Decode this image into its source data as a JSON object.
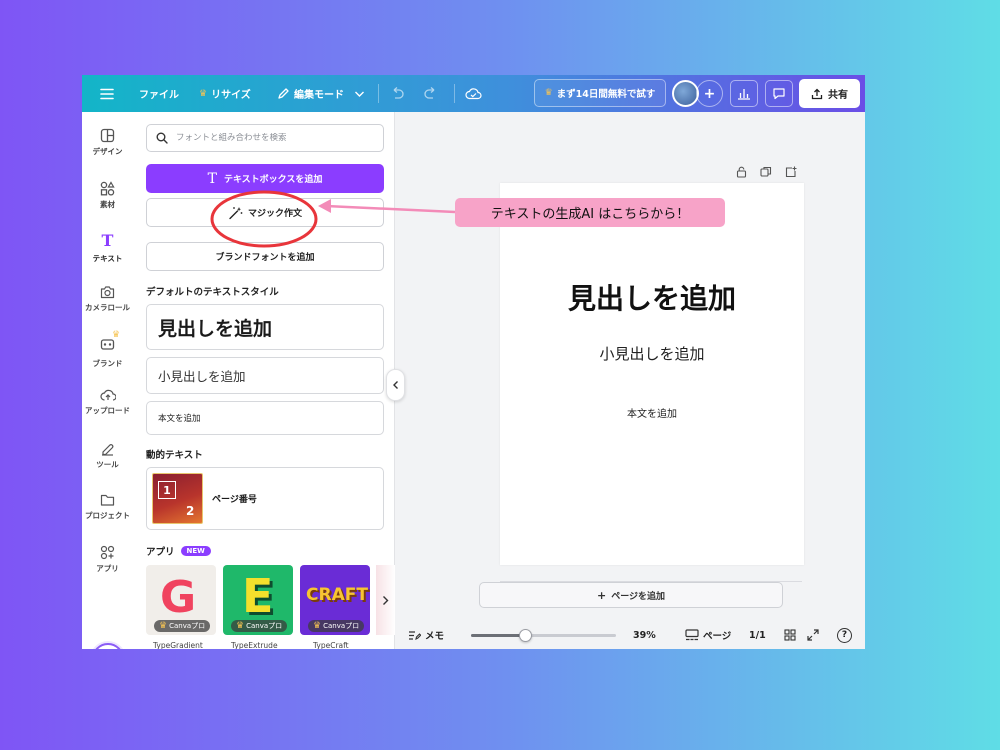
{
  "colors": {
    "accent": "#8b3dff",
    "topbar_start": "#13b5c8",
    "topbar_end": "#6b4ee6",
    "callout_bg": "#f7a3c8",
    "annotation_red": "#e8353b",
    "annotation_pink": "#f38bb8"
  },
  "topbar": {
    "menu_icon": "hamburger-icon",
    "file": "ファイル",
    "resize": "リサイズ",
    "edit_mode": "編集モード",
    "trial": "まず14日間無料で試す",
    "share": "共有"
  },
  "rail": {
    "items": [
      {
        "label": "デザイン",
        "icon": "design-icon"
      },
      {
        "label": "素材",
        "icon": "elements-icon"
      },
      {
        "label": "テキスト",
        "icon": "text-icon"
      },
      {
        "label": "カメラロール",
        "icon": "camera-icon"
      },
      {
        "label": "ブランド",
        "icon": "brand-icon"
      },
      {
        "label": "アップロード",
        "icon": "upload-icon"
      },
      {
        "label": "ツール",
        "icon": "tools-icon"
      },
      {
        "label": "プロジェクト",
        "icon": "folder-icon"
      },
      {
        "label": "アプリ",
        "icon": "apps-icon"
      }
    ]
  },
  "panel": {
    "search_placeholder": "フォントと組み合わせを検索",
    "add_textbox": "テキストボックスを追加",
    "magic_write": "マジック作文",
    "brand_fonts": "ブランドフォントを追加",
    "default_styles_title": "デフォルトのテキストスタイル",
    "heading": "見出しを追加",
    "subheading": "小見出しを追加",
    "body_text": "本文を追加",
    "dynamic_title": "動的テキスト",
    "page_number": "ページ番号",
    "page_thumb_1": "1",
    "page_thumb_2": "2",
    "apps_title": "アプリ",
    "new_badge": "NEW",
    "apps": [
      {
        "name": "TypeGradient",
        "badge": "Canvaプロ",
        "glyph": "G"
      },
      {
        "name": "TypeExtrude",
        "badge": "Canvaプロ",
        "glyph": "E"
      },
      {
        "name": "TypeCraft",
        "badge": "Canvaプロ",
        "glyph": "CRAFT"
      }
    ]
  },
  "canvas": {
    "heading": "見出しを追加",
    "subheading": "小見出しを追加",
    "body": "本文を追加",
    "add_page": "ページを追加"
  },
  "bottombar": {
    "notes": "メモ",
    "zoom": "39%",
    "zoom_fraction": 0.39,
    "pages": "ページ",
    "page_count": "1/1",
    "help": "?"
  },
  "annotation": {
    "callout": "テキストの生成AI はこちらから！"
  }
}
